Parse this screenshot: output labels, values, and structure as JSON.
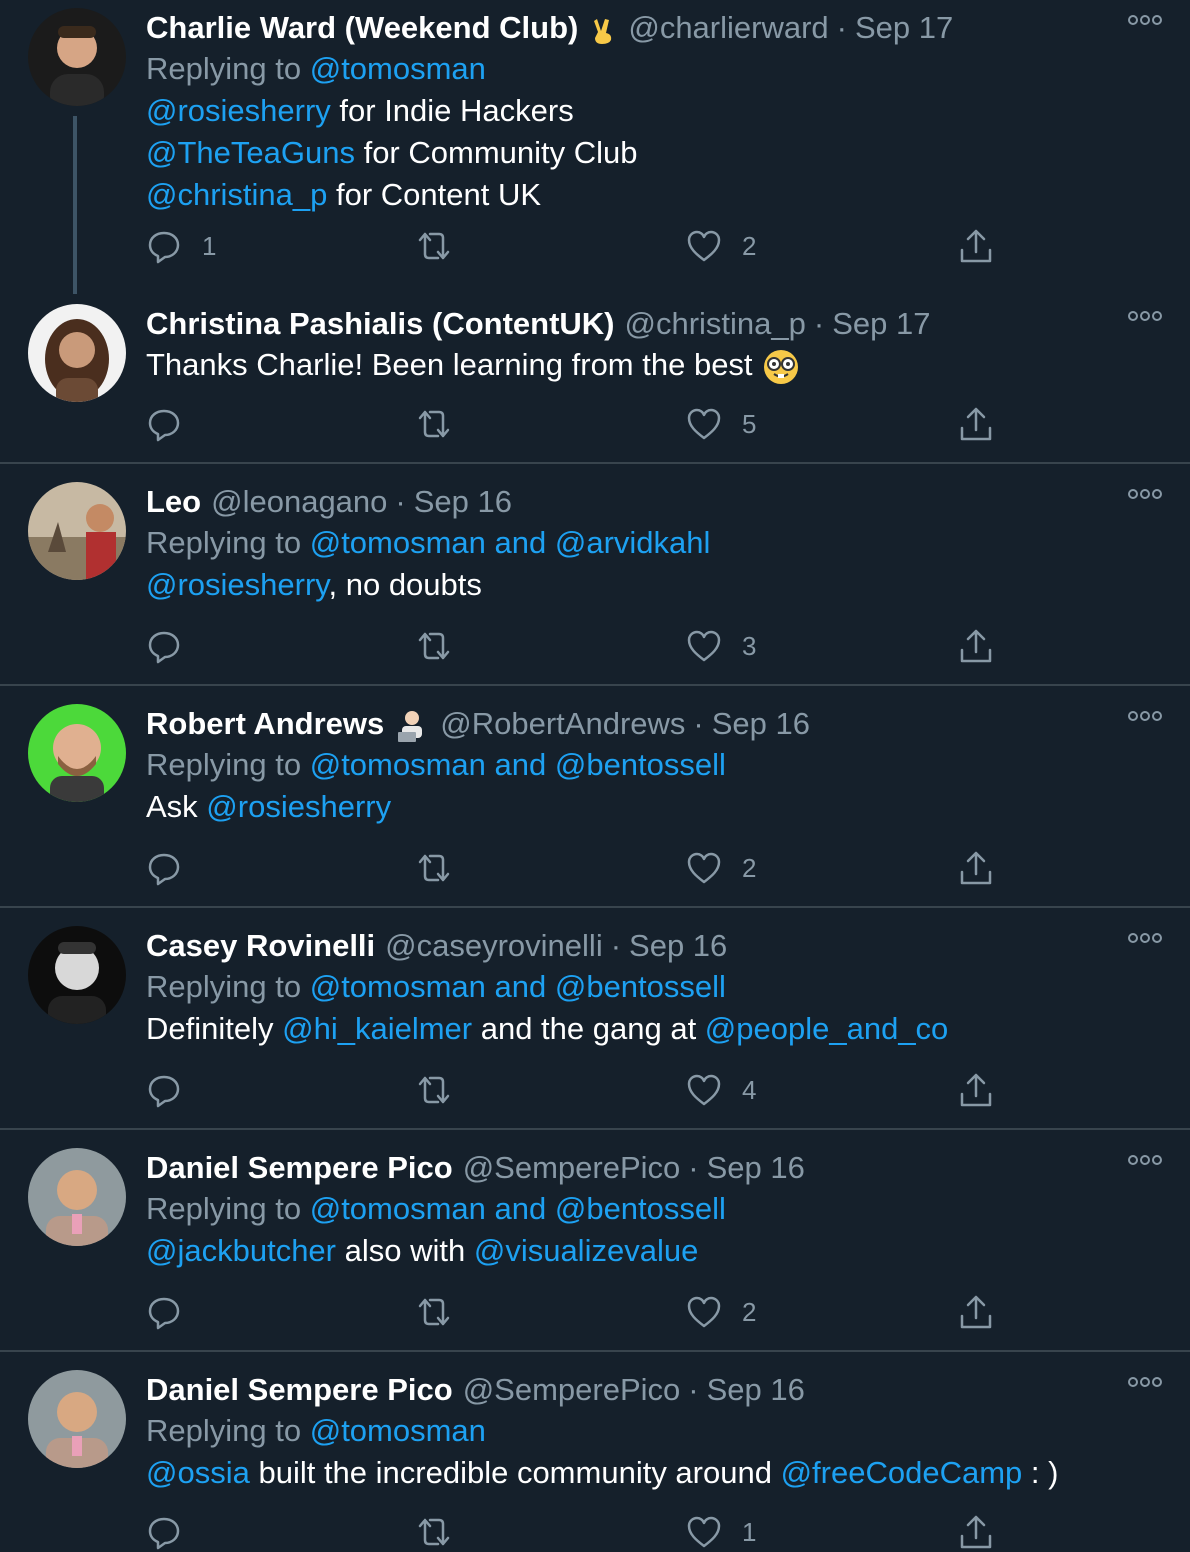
{
  "tweets": [
    {
      "name": "Charlie Ward (Weekend Club)",
      "handle": "@charlierward",
      "sep": "·",
      "date": "Sep 17",
      "replying_prefix": "Replying to",
      "replying_to": "@tomosman",
      "lines": [
        [
          {
            "t": "@rosiesherry",
            "l": true
          },
          {
            "t": " for Indie Hackers",
            "l": false
          }
        ],
        [
          {
            "t": "@TheTeaGuns",
            "l": true
          },
          {
            "t": " for Community Club",
            "l": false
          }
        ],
        [
          {
            "t": "@christina_p",
            "l": true
          },
          {
            "t": " for Content UK",
            "l": false
          }
        ]
      ],
      "reply_count": "1",
      "retweet_count": "",
      "like_count": "2"
    },
    {
      "name": "Christina Pashialis (ContentUK)",
      "handle": "@christina_p",
      "sep": "·",
      "date": "Sep 17",
      "lines": [
        [
          {
            "t": "Thanks Charlie! Been learning from the best",
            "l": false
          }
        ]
      ],
      "reply_count": "",
      "retweet_count": "",
      "like_count": "5"
    },
    {
      "name": "Leo",
      "handle": "@leonagano",
      "sep": "·",
      "date": "Sep 16",
      "replying_prefix": "Replying to",
      "replying_to": "@tomosman and @arvidkahl",
      "lines": [
        [
          {
            "t": "@rosiesherry",
            "l": true
          },
          {
            "t": ", no doubts",
            "l": false
          }
        ]
      ],
      "reply_count": "",
      "retweet_count": "",
      "like_count": "3"
    },
    {
      "name": "Robert Andrews",
      "handle": "@RobertAndrews",
      "sep": "·",
      "date": "Sep 16",
      "replying_prefix": "Replying to",
      "replying_to": "@tomosman and @bentossell",
      "lines": [
        [
          {
            "t": "Ask ",
            "l": false
          },
          {
            "t": "@rosiesherry",
            "l": true
          }
        ]
      ],
      "reply_count": "",
      "retweet_count": "",
      "like_count": "2"
    },
    {
      "name": "Casey Rovinelli",
      "handle": "@caseyrovinelli",
      "sep": "·",
      "date": "Sep 16",
      "replying_prefix": "Replying to",
      "replying_to": "@tomosman and @bentossell",
      "lines": [
        [
          {
            "t": "Definitely ",
            "l": false
          },
          {
            "t": "@hi_kaielmer",
            "l": true
          },
          {
            "t": " and the gang at ",
            "l": false
          },
          {
            "t": "@people_and_co",
            "l": true
          }
        ]
      ],
      "reply_count": "",
      "retweet_count": "",
      "like_count": "4"
    },
    {
      "name": "Daniel Sempere Pico",
      "handle": "@SemperePico",
      "sep": "·",
      "date": "Sep 16",
      "replying_prefix": "Replying to",
      "replying_to": "@tomosman and @bentossell",
      "lines": [
        [
          {
            "t": "@jackbutcher",
            "l": true
          },
          {
            "t": " also with ",
            "l": false
          },
          {
            "t": "@visualizevalue",
            "l": true
          }
        ]
      ],
      "reply_count": "",
      "retweet_count": "",
      "like_count": "2"
    },
    {
      "name": "Daniel Sempere Pico",
      "handle": "@SemperePico",
      "sep": "·",
      "date": "Sep 16",
      "replying_prefix": "Replying to",
      "replying_to": "@tomosman",
      "lines": [
        [
          {
            "t": "@ossia",
            "l": true
          },
          {
            "t": " built the incredible community around ",
            "l": false
          },
          {
            "t": "@freeCodeCamp",
            "l": true
          },
          {
            "t": " : )",
            "l": false
          }
        ]
      ],
      "reply_count": "",
      "retweet_count": "",
      "like_count": "1"
    }
  ],
  "icons": {
    "reply": "reply-icon",
    "retweet": "retweet-icon",
    "like": "heart-icon",
    "share": "share-icon",
    "more": "more-icon"
  },
  "colors": {
    "background": "#15202b",
    "border": "#38444d",
    "link": "#1da1f2",
    "muted": "#8899a6",
    "text": "#ffffff"
  }
}
